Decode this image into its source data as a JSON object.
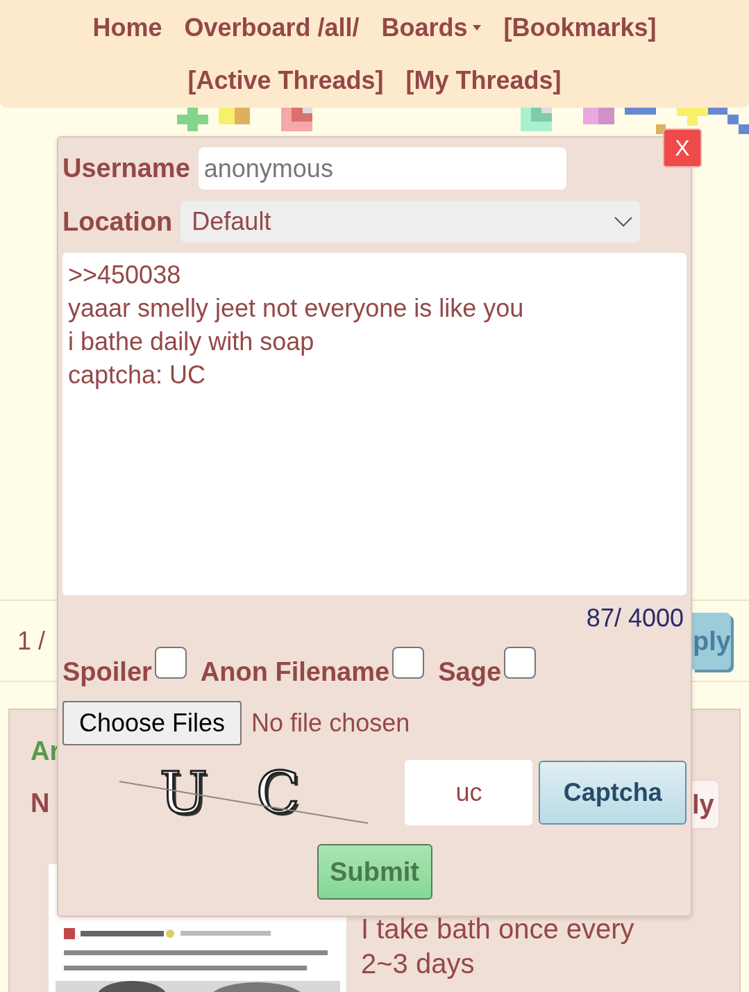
{
  "nav": {
    "links": [
      {
        "label": "Home",
        "has_menu": false
      },
      {
        "label": "Overboard /all/",
        "has_menu": false
      },
      {
        "label": "Boards",
        "has_menu": true
      },
      {
        "label": "[Bookmarks]",
        "has_menu": false
      },
      {
        "label": "[Active Threads]",
        "has_menu": false
      },
      {
        "label": "[My Threads]",
        "has_menu": false
      }
    ]
  },
  "thread_bar": {
    "page": "1 /",
    "button": "ply"
  },
  "post": {
    "name": "Ar",
    "number": "N",
    "button": "ly",
    "image": {
      "kind": "picture"
    },
    "body": [
      "I take bath once every",
      "2~3 days"
    ]
  },
  "reply_form": {
    "close": "X",
    "username": {
      "label": "Username",
      "placeholder": "anonymous"
    },
    "location": {
      "label": "Location",
      "value": "Default"
    },
    "message": {
      "value": ">>450038\nyaaar smelly jeet not everyone is like you\ni bathe daily with soap\ncaptcha: UC"
    },
    "counter": "87/ 4000",
    "options": [
      {
        "label": "Spoiler",
        "checked": false
      },
      {
        "label": "Anon Filename",
        "checked": false
      },
      {
        "label": "Sage",
        "checked": false
      }
    ],
    "file": {
      "button": "Choose Files",
      "status": "No file chosen"
    },
    "captcha": {
      "image_chars": [
        "U",
        "C"
      ],
      "value": "uc",
      "button": "Captcha"
    },
    "submit": "Submit"
  }
}
